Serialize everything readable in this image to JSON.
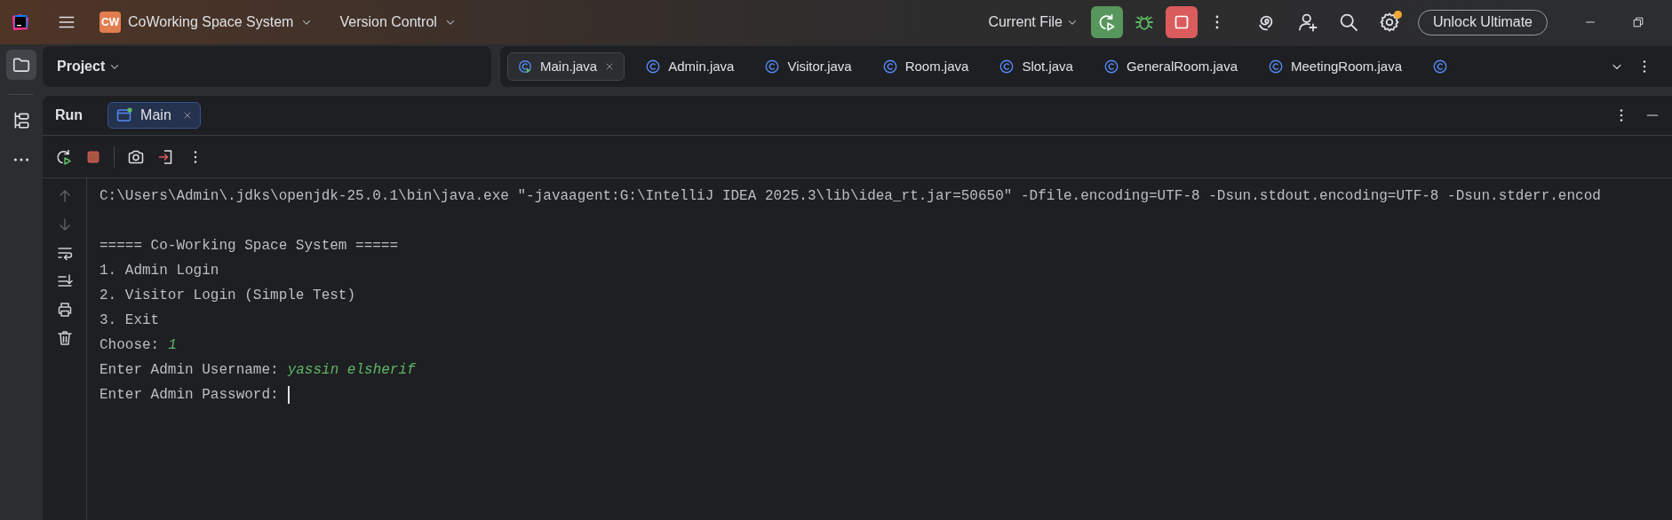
{
  "top_bar": {
    "project_badge": "CW",
    "project_name": "CoWorking Space System",
    "vcs_menu": "Version Control",
    "run_config": "Current File",
    "unlock_button": "Unlock Ultimate",
    "settings_notification": true
  },
  "tool_windows": [
    {
      "kind": "project",
      "selected": true
    },
    {
      "kind": "structure",
      "selected": false
    }
  ],
  "project_panel": {
    "title": "Project"
  },
  "editor_tabs": [
    {
      "kind": "main",
      "label": "Main.java",
      "selected": true
    },
    {
      "kind": "class",
      "label": "Admin.java",
      "selected": false
    },
    {
      "kind": "class",
      "label": "Visitor.java",
      "selected": false
    },
    {
      "kind": "class",
      "label": "Room.java",
      "selected": false
    },
    {
      "kind": "class",
      "label": "Slot.java",
      "selected": false
    },
    {
      "kind": "class",
      "label": "GeneralRoom.java",
      "selected": false
    },
    {
      "kind": "class",
      "label": "MeetingRoom.java",
      "selected": false
    },
    {
      "kind": "class",
      "selected": false
    }
  ],
  "run_panel": {
    "title": "Run",
    "tabs": [
      {
        "label": "Main",
        "selected": true
      }
    ],
    "console_actions": [
      {
        "kind": "up",
        "disabled": true
      },
      {
        "kind": "down",
        "disabled": true
      },
      {
        "kind": "wrap",
        "disabled": false
      },
      {
        "kind": "scroll_end",
        "disabled": false
      },
      {
        "kind": "print",
        "disabled": false
      },
      {
        "kind": "clear",
        "disabled": false
      }
    ],
    "console_lines": [
      {
        "kind": "output",
        "text": "C:\\Users\\Admin\\.jdks\\openjdk-25.0.1\\bin\\java.exe \"-javaagent:G:\\IntelliJ IDEA 2025.3\\lib\\idea_rt.jar=50650\" -Dfile.encoding=UTF-8 -Dsun.stdout.encoding=UTF-8 -Dsun.stderr.encod"
      },
      {
        "kind": "blank"
      },
      {
        "kind": "output",
        "text": "===== Co-Working Space System ====="
      },
      {
        "kind": "output",
        "text": "1. Admin Login"
      },
      {
        "kind": "output",
        "text": "2. Visitor Login (Simple Test)"
      },
      {
        "kind": "output",
        "text": "3. Exit"
      },
      {
        "kind": "prompt",
        "text": "Choose:",
        "input": "1"
      },
      {
        "kind": "prompt",
        "text": "Enter Admin Username:",
        "input": "yassin elsherif"
      },
      {
        "kind": "prompt",
        "text": "Enter Admin Password:",
        "cursor": true
      }
    ]
  }
}
